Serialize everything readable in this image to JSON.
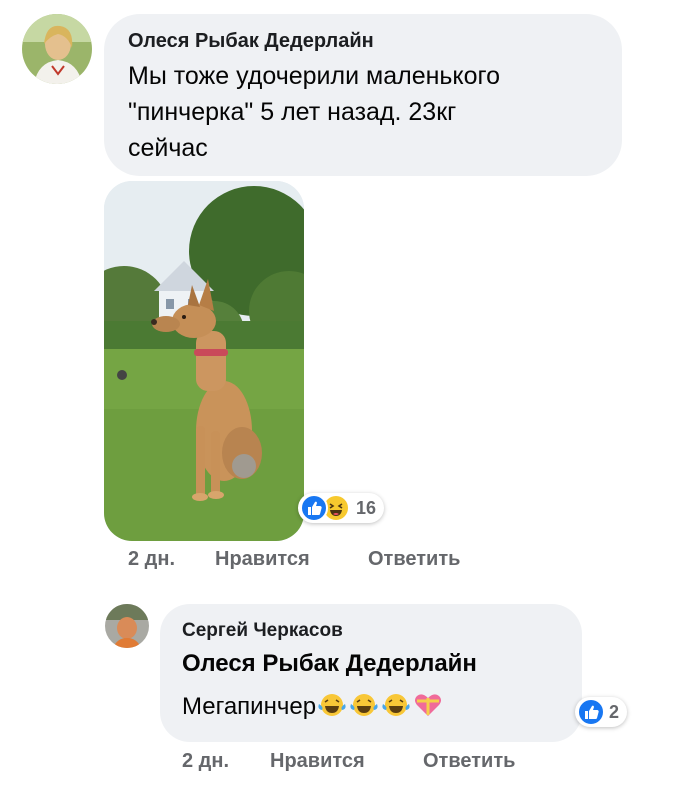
{
  "comment1": {
    "author": "Олеся Рыбак Дедерлайн",
    "text_lines": [
      "Мы тоже удочерили маленького",
      "\"пинчерка\" 5 лет назад. 23кг",
      "сейчас"
    ],
    "reaction_count": "16",
    "time": "2 дн.",
    "like_label": "Нравится",
    "reply_label": "Ответить"
  },
  "comment2": {
    "author": "Сергей Черкасов",
    "mention": "Олеся Рыбак Дедерлайн",
    "text": "Мегапинчер",
    "reaction_count": "2",
    "time": "2 дн.",
    "like_label": "Нравится",
    "reply_label": "Ответить"
  },
  "colors": {
    "bubble": "#eff1f4",
    "like_blue": "#1877f2",
    "meta_gray": "#65676b"
  },
  "icons": [
    "like-icon",
    "haha-icon",
    "tears-of-joy-emoji",
    "gift-heart-emoji"
  ]
}
